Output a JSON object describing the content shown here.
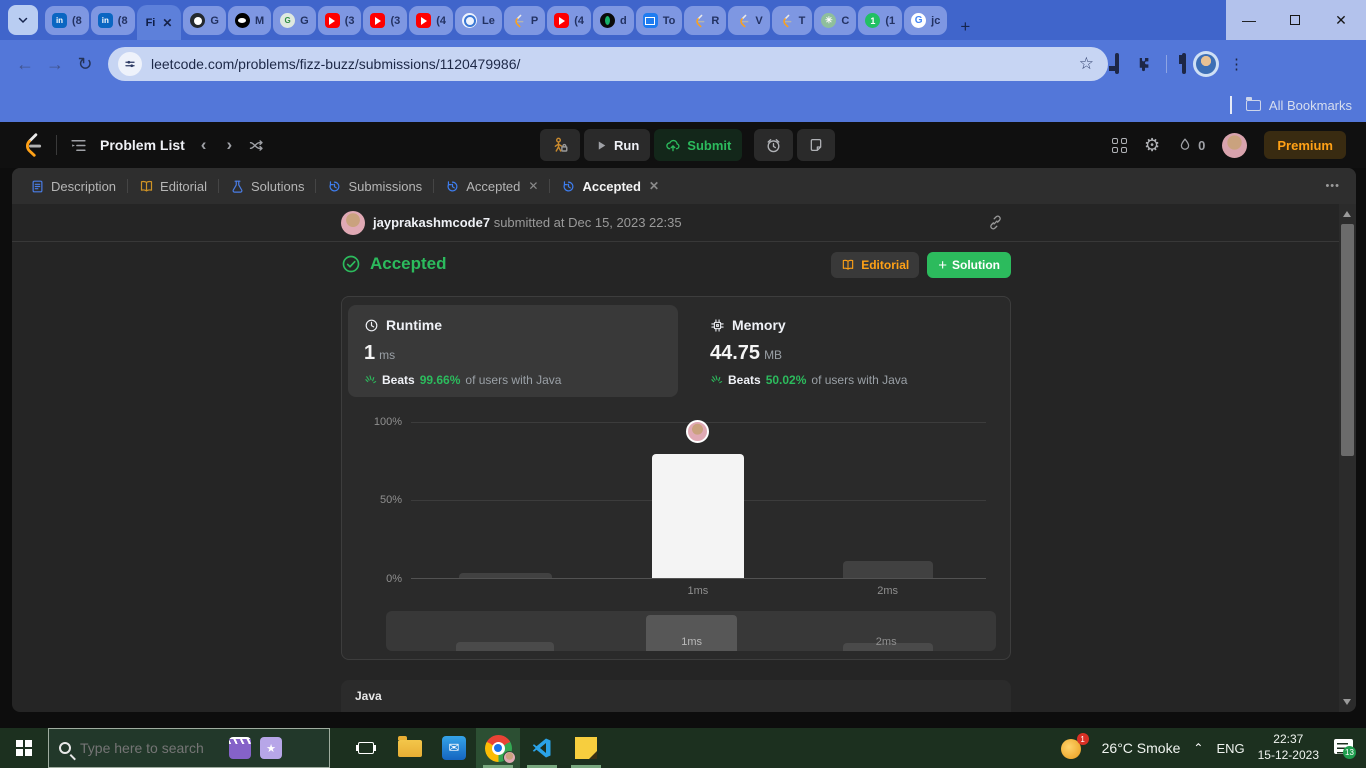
{
  "browser": {
    "tabs": [
      {
        "icon": "linkedin",
        "label": "(8"
      },
      {
        "icon": "linkedin",
        "label": "(8"
      },
      {
        "icon": "leetcode",
        "label": "Fi",
        "active": true
      },
      {
        "icon": "github",
        "label": "G"
      },
      {
        "icon": "medium",
        "label": "M"
      },
      {
        "icon": "gfg",
        "label": "G"
      },
      {
        "icon": "youtube",
        "label": "(3"
      },
      {
        "icon": "youtube",
        "label": "(3"
      },
      {
        "icon": "youtube",
        "label": "(4"
      },
      {
        "icon": "globe",
        "label": "Le"
      },
      {
        "icon": "leetcode",
        "label": "P"
      },
      {
        "icon": "youtube",
        "label": "(4"
      },
      {
        "icon": "dark-app",
        "label": "d"
      },
      {
        "icon": "blue-app",
        "label": "To"
      },
      {
        "icon": "leetcode",
        "label": "R"
      },
      {
        "icon": "leetcode",
        "label": "V"
      },
      {
        "icon": "leetcode",
        "label": "T"
      },
      {
        "icon": "chatgpt",
        "label": "C"
      },
      {
        "icon": "green-badge",
        "label": "(1"
      },
      {
        "icon": "google",
        "label": "jc"
      }
    ],
    "url": "leetcode.com/problems/fizz-buzz/submissions/1120479986/",
    "all_bookmarks": "All Bookmarks"
  },
  "nav": {
    "problem_list": "Problem List",
    "run": "Run",
    "submit": "Submit",
    "streak": "0",
    "premium": "Premium"
  },
  "tabs": {
    "items": [
      {
        "label": "Description"
      },
      {
        "label": "Editorial"
      },
      {
        "label": "Solutions"
      },
      {
        "label": "Submissions"
      },
      {
        "label": "Accepted",
        "closable": true
      },
      {
        "label": "Accepted",
        "closable": true,
        "active": true
      }
    ],
    "more": "•••"
  },
  "submission": {
    "username": "jayprakashmcode7",
    "meta": " submitted at Dec 15, 2023 22:35",
    "status": "Accepted",
    "editorial_button": "Editorial",
    "solution_button": "Solution",
    "solution_plus": "+"
  },
  "stats": {
    "runtime": {
      "label": "Runtime",
      "value": "1",
      "unit": "ms",
      "beats_word": "Beats",
      "beats": "99.66%",
      "rest": "of users with Java"
    },
    "memory": {
      "label": "Memory",
      "value": "44.75",
      "unit": "MB",
      "beats_word": "Beats",
      "beats": "50.02%",
      "rest": "of users with Java"
    }
  },
  "chart_data": {
    "type": "bar",
    "title": "Runtime percentile distribution",
    "categories": [
      "0ms",
      "1ms",
      "2ms"
    ],
    "values": [
      3,
      79,
      11
    ],
    "xtick_labels": [
      "",
      "1ms",
      "2ms"
    ],
    "ytick_labels": [
      "100%",
      "50%",
      "0%"
    ],
    "ylim": [
      0,
      100
    ],
    "grid": true,
    "highlight_index": 1,
    "annotation": "user avatar marker above the 1ms bar",
    "brush": {
      "selected": "1ms",
      "labels": [
        "1ms",
        "2ms"
      ]
    }
  },
  "code": {
    "lang": "Java"
  },
  "taskbar": {
    "search_placeholder": "Type here to search",
    "weather_badge": "1",
    "temp": "26°C",
    "condition": "Smoke",
    "lang": "ENG",
    "time": "22:37",
    "date": "15-12-2023",
    "notif_count": "13"
  },
  "colors": {
    "accent_green": "#2cbb5d",
    "accent_orange": "#ffa116",
    "chrome_blue": "#5377d9",
    "taskbar_green": "#1c301f"
  }
}
